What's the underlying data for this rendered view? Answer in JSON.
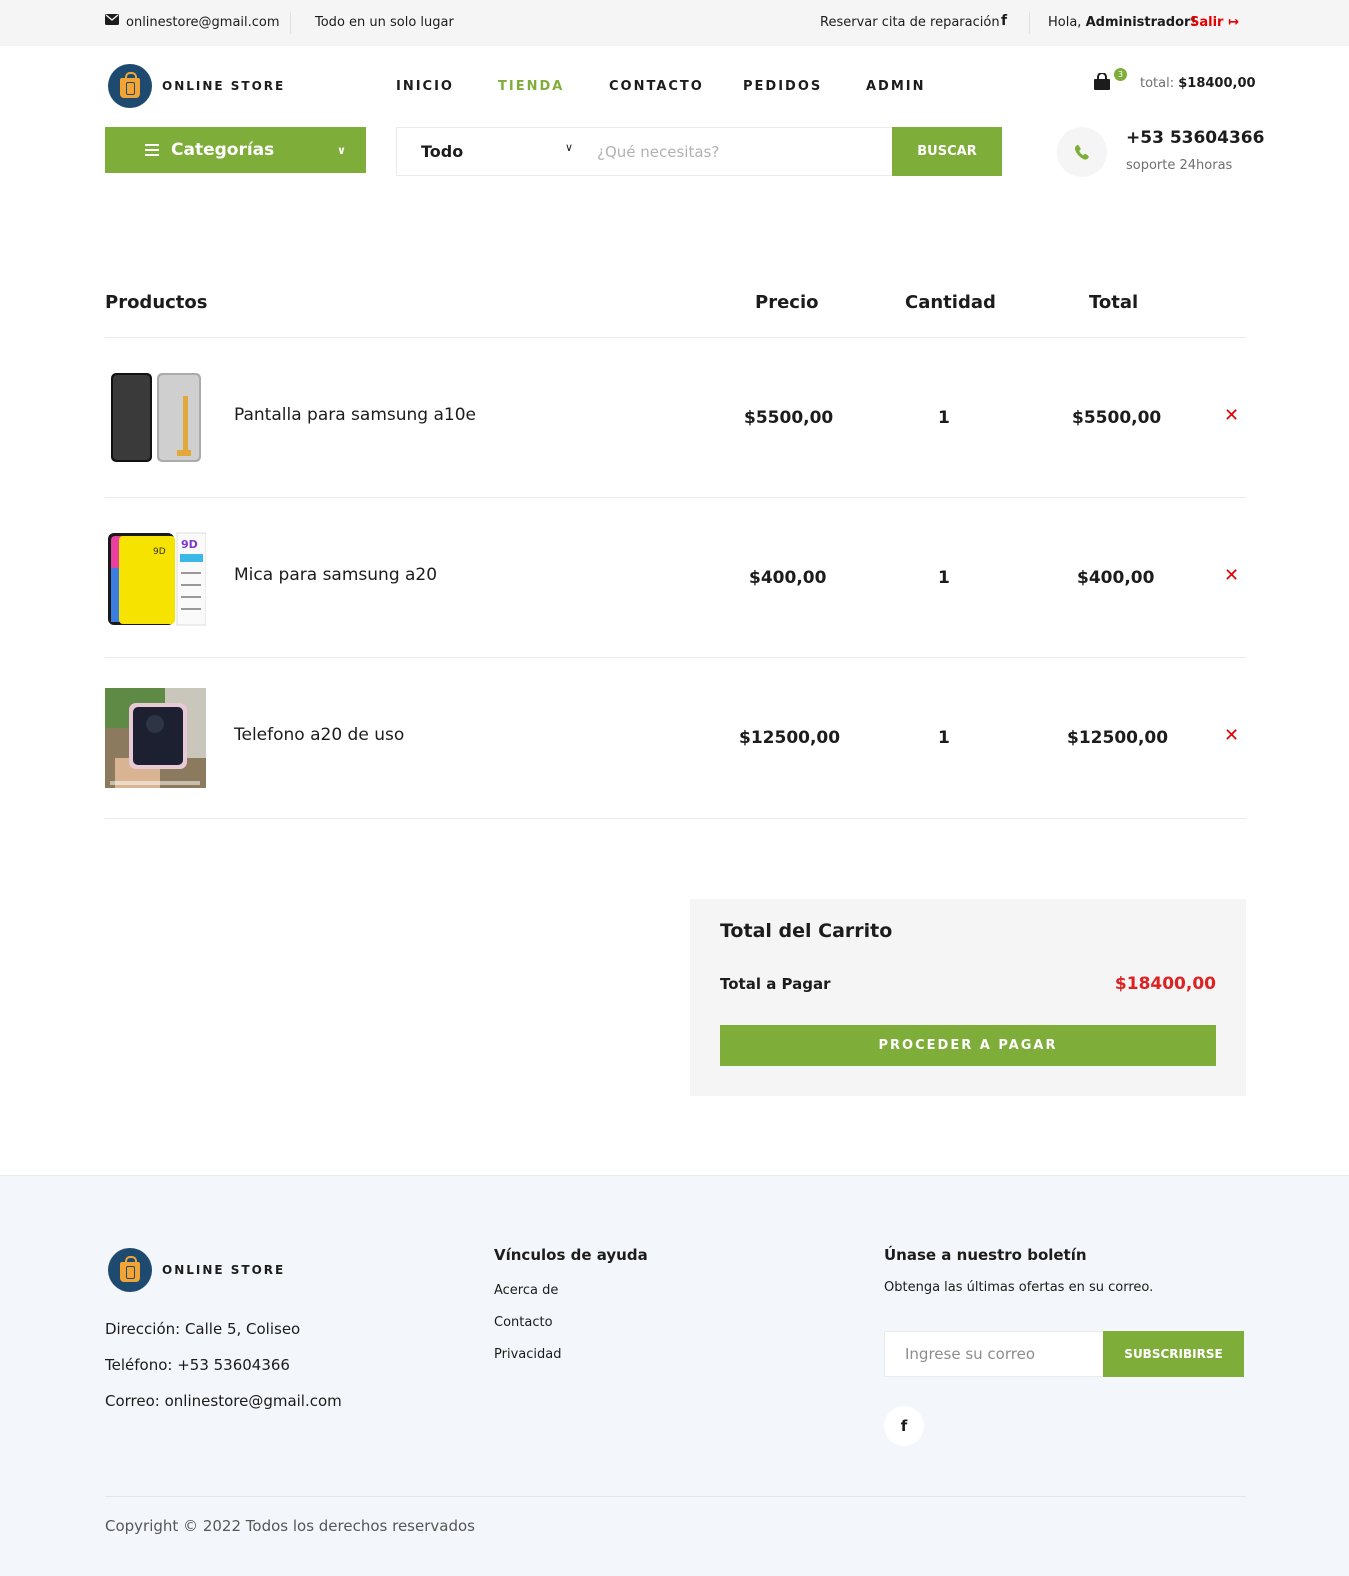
{
  "topbar": {
    "email": "onlinestore@gmail.com",
    "tagline": "Todo en un solo lugar",
    "repair_link": "Reservar cita de reparación",
    "greeting": "Hola,",
    "user": "Administrador!",
    "logout": "Salir"
  },
  "brand": {
    "name": "ONLINE STORE"
  },
  "nav": [
    {
      "label": "INICIO",
      "active": false
    },
    {
      "label": "TIENDA",
      "active": true
    },
    {
      "label": "CONTACTO",
      "active": false
    },
    {
      "label": "PEDIDOS",
      "active": false
    },
    {
      "label": "ADMIN",
      "active": false
    }
  ],
  "cart": {
    "count": "3",
    "total_label": "total:",
    "total_value": "$18400,00"
  },
  "categories": {
    "label": "Categorías"
  },
  "search": {
    "category": "Todo",
    "placeholder": "¿Qué necesitas?",
    "button": "BUSCAR"
  },
  "support": {
    "phone": "+53 53604366",
    "hours": "soporte 24horas"
  },
  "table": {
    "headers": {
      "product": "Productos",
      "price": "Precio",
      "qty": "Cantidad",
      "total": "Total"
    },
    "rows": [
      {
        "name": "Pantalla para samsung a10e",
        "price": "$5500,00",
        "qty": "1",
        "total": "$5500,00"
      },
      {
        "name": "Mica para samsung a20",
        "price": "$400,00",
        "qty": "1",
        "total": "$400,00"
      },
      {
        "name": "Telefono a20 de uso",
        "price": "$12500,00",
        "qty": "1",
        "total": "$12500,00"
      }
    ]
  },
  "summary": {
    "title": "Total del Carrito",
    "label": "Total a Pagar",
    "amount": "$18400,00",
    "button": "PROCEDER A PAGAR"
  },
  "footer": {
    "address": "Dirección: Calle 5, Coliseo",
    "phone": "Teléfono: +53 53604366",
    "email": "Correo: onlinestore@gmail.com",
    "links_title": "Vínculos de ayuda",
    "links": [
      "Acerca de",
      "Contacto",
      "Privacidad"
    ],
    "newsletter_title": "Únase a nuestro boletín",
    "newsletter_text": "Obtenga las últimas ofertas en su correo.",
    "newsletter_placeholder": "Ingrese su correo",
    "newsletter_button": "SUBSCRIBIRSE",
    "copyright": "Copyright © 2022 Todos los derechos reservados"
  },
  "colors": {
    "accent": "#7fad39",
    "danger": "#e60000",
    "price_total": "#dd2222"
  }
}
